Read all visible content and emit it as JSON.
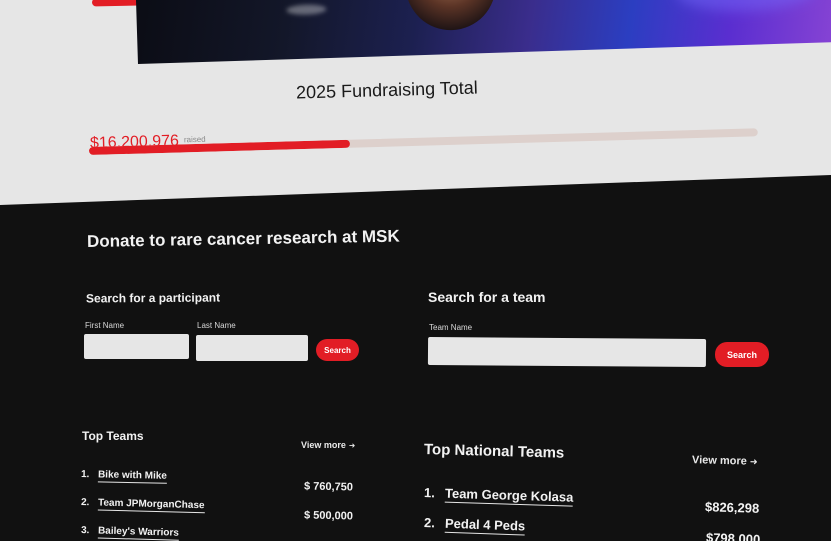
{
  "fundraising": {
    "title": "2025 Fundraising Total",
    "amount": "$16,200,976",
    "amount_label": "raised",
    "progress_percent": 39
  },
  "colors": {
    "accent": "#e21d25",
    "dark_bg": "#111111",
    "light_bg": "#e6e6e6",
    "progress_track": "#ddd0cc"
  },
  "donate": {
    "heading": "Donate to rare cancer research at MSK"
  },
  "participant_search": {
    "title": "Search for a participant",
    "first_name_label": "First Name",
    "last_name_label": "Last Name",
    "first_name_value": "",
    "last_name_value": "",
    "button_label": "Search"
  },
  "team_search": {
    "title": "Search for a team",
    "team_name_label": "Team Name",
    "team_name_value": "",
    "button_label": "Search"
  },
  "top_teams": {
    "title": "Top Teams",
    "view_more": "View more",
    "arrow_icon": "arrow-right-icon",
    "items": [
      {
        "rank": "1.",
        "name": "Bike with Mike",
        "amount": "$ 760,750"
      },
      {
        "rank": "2.",
        "name": "Team JPMorganChase",
        "amount": "$ 500,000"
      },
      {
        "rank": "3.",
        "name": "Bailey's Warriors",
        "amount": ""
      }
    ]
  },
  "top_national_teams": {
    "title": "Top National Teams",
    "view_more": "View more",
    "arrow_icon": "arrow-right-icon",
    "items": [
      {
        "rank": "1.",
        "name": "Team George Kolasa",
        "amount": "$826,298"
      },
      {
        "rank": "2.",
        "name": "Pedal 4 Peds",
        "amount": "$798,000"
      }
    ]
  }
}
